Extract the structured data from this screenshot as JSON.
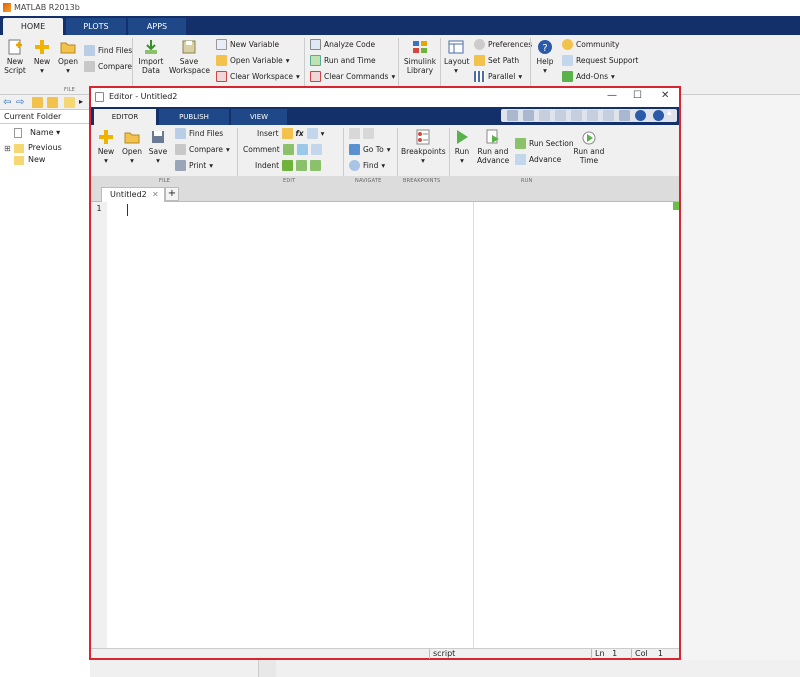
{
  "app": {
    "title": "MATLAB R2013b"
  },
  "main_tabs": [
    {
      "label": "HOME"
    },
    {
      "label": "PLOTS"
    },
    {
      "label": "APPS"
    }
  ],
  "main_ribbon": {
    "new_script": {
      "line1": "New",
      "line2": "Script"
    },
    "new": "New",
    "open": "Open",
    "find_files": "Find Files",
    "compare": "Compare",
    "import": {
      "line1": "Import",
      "line2": "Data"
    },
    "save_ws": {
      "line1": "Save",
      "line2": "Workspace"
    },
    "new_variable": "New Variable",
    "open_variable": "Open Variable",
    "clear_workspace": "Clear Workspace",
    "analyze_code": "Analyze Code",
    "run_and_time": "Run and Time",
    "clear_commands": "Clear Commands",
    "simulink": {
      "line1": "Simulink",
      "line2": "Library"
    },
    "layout": "Layout",
    "preferences": "Preferences",
    "set_path": "Set Path",
    "parallel": "Parallel",
    "help": "Help",
    "community": "Community",
    "request_support": "Request Support",
    "add_ons": "Add-Ons",
    "file_section": "FILE"
  },
  "current_folder": {
    "title": "Current Folder",
    "name_col": "Name",
    "items": [
      "Previous",
      "New"
    ]
  },
  "editor": {
    "title": "Editor - Untitled2",
    "tabs": [
      {
        "label": "EDITOR"
      },
      {
        "label": "PUBLISH"
      },
      {
        "label": "VIEW"
      }
    ],
    "file": {
      "new": "New",
      "open": "Open",
      "save": "Save",
      "find_files": "Find Files",
      "compare": "Compare",
      "print": "Print"
    },
    "edit": {
      "insert": "Insert",
      "comment": "Comment",
      "indent": "Indent",
      "fx": "fx"
    },
    "navigate": {
      "go_to": "Go To",
      "find": "Find"
    },
    "breakpoints": "Breakpoints",
    "run": {
      "run": "Run",
      "run_advance_1": "Run and",
      "run_advance_2": "Advance",
      "run_section": "Run Section",
      "advance": "Advance",
      "run_time_1": "Run and",
      "run_time_2": "Time"
    },
    "sections": [
      "FILE",
      "EDIT",
      "NAVIGATE",
      "BREAKPOINTS",
      "RUN"
    ],
    "doc_tab": "Untitled2",
    "line_number": "1",
    "status": {
      "mode": "script",
      "ln_label": "Ln",
      "ln": "1",
      "col_label": "Col",
      "col": "1"
    }
  },
  "colors": {
    "accent": "#13306a",
    "highlight": "#d7262f"
  }
}
